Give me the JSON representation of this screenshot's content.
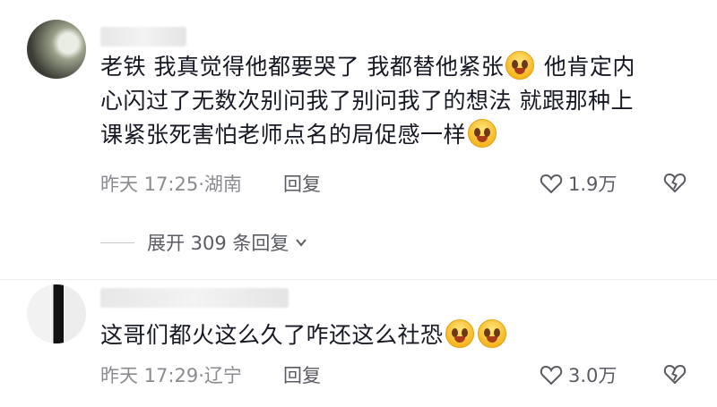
{
  "comments": [
    {
      "lines": [
        [
          "老铁 我真觉得他都要哭了 我都替他紧张",
          "emoji",
          " 他肯定内"
        ],
        [
          "心闪过了无数次别问我了别问我了的想法 就跟那种上"
        ],
        [
          "课紧张死害怕老师点名的局促感一样",
          "emoji"
        ]
      ],
      "time": "昨天 17:25·湖南",
      "reply": "回复",
      "likes": "1.9万"
    },
    {
      "lines": [
        [
          "这哥们都火这么久了咋还这么社恐",
          "emoji",
          "emoji"
        ]
      ],
      "time": "昨天 17:29·辽宁",
      "reply": "回复",
      "likes": "3.0万"
    }
  ],
  "expand_replies": "展开 309 条回复",
  "icons": {
    "emoji": "loudly-crying-face",
    "like": "heart-outline-icon",
    "dislike": "broken-heart-icon",
    "expand": "chevron-down-icon"
  }
}
